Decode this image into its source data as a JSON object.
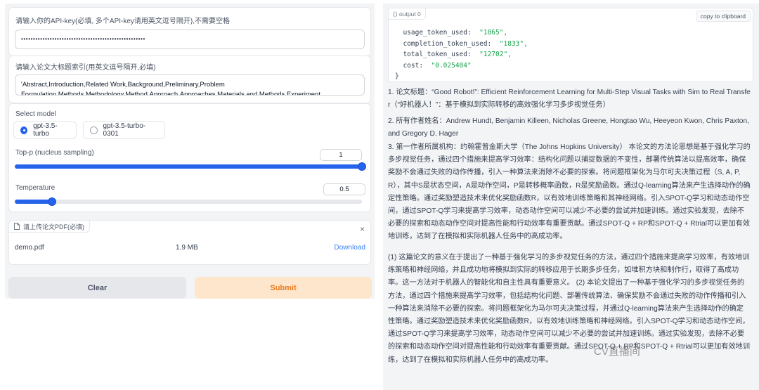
{
  "form": {
    "api_key_label": "请输入你的API-key(必填, 多个API-key请用英文逗号隔开),不需要空格",
    "api_key_value": "••••••••••••••••••••••••••••••••••••••••••••••••••••",
    "keywords_label": "请输入论文大标题索引(用英文逗号隔开,必填)",
    "keywords_line1": "'Abstract,Introduction,Related Work,Background,Preliminary,Problem",
    "keywords_line2": "Formulation,Methods,Methodology,Method,Approach,Approaches,Materials and Methods,Experiment",
    "model_label": "Select model",
    "model_options": [
      "gpt-3.5-turbo",
      "gpt-3.5-turbo-0301"
    ],
    "model_selected": "gpt-3.5-turbo",
    "top_p_label": "Top-p (nucleus sampling)",
    "top_p_value": "1",
    "top_p_fraction": 1.0,
    "temperature_label": "Temperature",
    "temperature_value": "0.5",
    "temperature_fraction": 0.108,
    "upload_label": "请上传论文PDF(必填)",
    "file_name": "demo.pdf",
    "file_size": "1.9 MB",
    "download_label": "Download",
    "close_symbol": "×",
    "clear_label": "Clear",
    "submit_label": "Submit"
  },
  "output": {
    "tag": "output 0",
    "copy_label": "copy to clipboard",
    "json_lines": [
      {
        "key": "usage_token_used:",
        "val": "\"1865\","
      },
      {
        "key": "completion_token_used:",
        "val": "\"1833\","
      },
      {
        "key": "total_token_used:",
        "val": "\"12702\","
      },
      {
        "key": "cost:",
        "val": "\"0.025404\""
      }
    ],
    "closing_brace": "}",
    "p1": "1. 论文标题：“Good Robot!”: Efficient Reinforcement Learning for Multi-Step Visual Tasks with Sim to Real Transfer（“好机器人！”：基于模拟到实际转移的高效强化学习多步视觉任务）",
    "p2": "2. 所有作者姓名：Andrew Hundt, Benjamin Killeen, Nicholas Greene, Hongtao Wu, Heeyeon Kwon, Chris Paxton, and Gregory D. Hager",
    "p3": "3. 第一作者所属机构：约翰霍普金斯大学（The Johns Hopkins University） 本论文的方法论思想是基于强化学习的多步视觉任务，通过四个措施来提高学习效率：结构化问题以捕捉数据的不变性，部署传统算法以提高效率，确保奖励不会通过失败的动作传播，引入一种算法来消除不必要的探索。将问题框架化为马尔可夫决策过程（S, A, P, R），其中S是状态空间，A是动作空间，P是转移概率函数，R是奖励函数。通过Q-learning算法来产生选择动作的确定性策略。通过奖励塑造技术来优化奖励函数R，以有效地训练策略和其神经网络。引入SPOT-Q学习和动态动作空间，通过SPOT-Q学习来提高学习效率，动态动作空间可以减少不必要的尝试并加速训练。通过实验发现，去除不必要的探索和动态动作空间对提高性能和行动效率有重要贡献。通过SPOT-Q + RP和SPOT-Q + Rtrial可以更加有效地训练，达到了在模拟和实际机器人任务中的高成功率。",
    "p4": "(1) 这篇论文的意义在于提出了一种基于强化学习的多步视觉任务的方法，通过四个措施来提高学习效率，有效地训练策略和神经网络，并且成功地将模拟到实际的转移应用于长期多步任务，如堆积方块和制作行，取得了高成功率。这一方法对于机器人的智能化和自主性具有重要意义。 (2) 本论文提出了一种基于强化学习的多步视觉任务的方法，通过四个措施来提高学习效率，包括结构化问题、部署传统算法、确保奖励不会通过失败的动作传播和引入一种算法来消除不必要的探索。将问题框架化为马尔可夫决策过程，并通过Q-learning算法来产生选择动作的确定性策略。通过奖励塑造技术来优化奖励函数R，以有效地训练策略和神经网络。引入SPOT-Q学习和动态动作空间，通过SPOT-Q学习来提高学习效率，动态动作空间可以减少不必要的尝试并加速训练。通过实验发现，去除不必要的探索和动态动作空间对提高性能和行动效率有重要贡献。通过SPOT-Q + RP和SPOT-Q + Rtrial可以更加有效地训练，达到了在模拟和实际机器人任务中的高成功率。"
  },
  "watermark": "CV直播间",
  "colors": {
    "accent": "#2563eb",
    "submit_bg": "#fde6cc",
    "submit_text": "#ea7a1f",
    "clear_bg": "#e5e7eb",
    "download_link": "#3b82f6"
  }
}
